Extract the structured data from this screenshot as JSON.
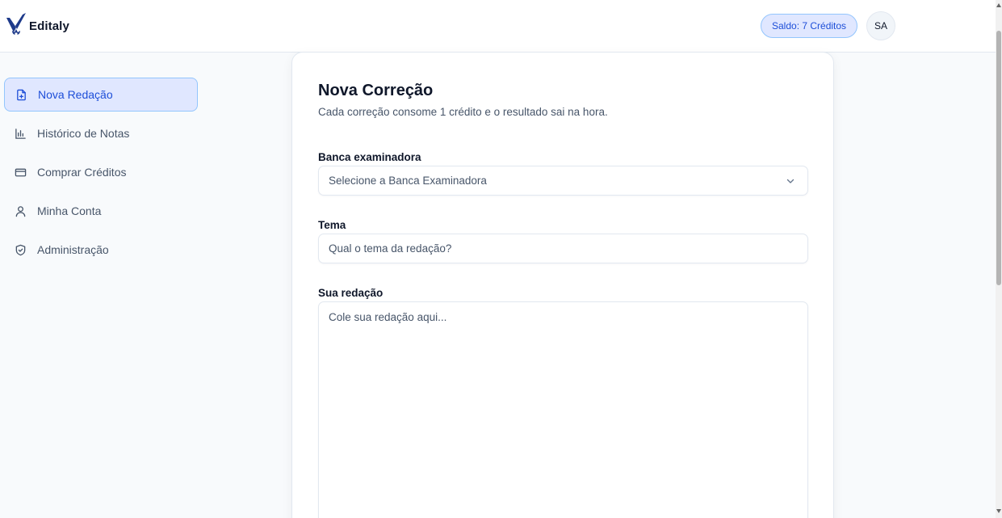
{
  "header": {
    "brand": "Editaly",
    "credits_badge": "Saldo: 7 Créditos",
    "avatar_initials": "SA"
  },
  "sidebar": {
    "items": [
      {
        "label": "Nova Redação",
        "icon": "file-plus-icon",
        "active": true
      },
      {
        "label": "Histórico de Notas",
        "icon": "bar-chart-icon",
        "active": false
      },
      {
        "label": "Comprar Créditos",
        "icon": "credit-card-icon",
        "active": false
      },
      {
        "label": "Minha Conta",
        "icon": "user-icon",
        "active": false
      },
      {
        "label": "Administração",
        "icon": "shield-check-icon",
        "active": false
      }
    ]
  },
  "form": {
    "title": "Nova Correção",
    "subtitle": "Cada correção consome 1 crédito e o resultado sai na hora.",
    "banca_label": "Banca examinadora",
    "banca_selected": "Selecione a Banca Examinadora",
    "tema_label": "Tema",
    "tema_placeholder": "Qual o tema da redação?",
    "redacao_label": "Sua redação",
    "redacao_placeholder": "Cole sua redação aqui..."
  },
  "colors": {
    "accent": "#1d4ed8",
    "accent_bg": "#e0e7ff",
    "accent_border": "#93c5fd",
    "logo_navy": "#1e3a8a"
  }
}
